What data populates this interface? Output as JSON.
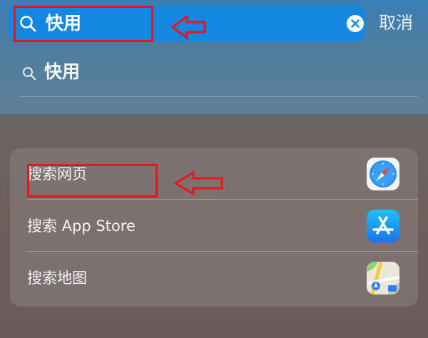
{
  "search": {
    "query": "快用",
    "cancel_label": "取消"
  },
  "suggestion": {
    "text": "快用"
  },
  "results": [
    {
      "label": "搜索网页",
      "icon": "safari-icon"
    },
    {
      "label": "搜索 App Store",
      "icon": "app-store-icon"
    },
    {
      "label": "搜索地图",
      "icon": "maps-icon"
    }
  ],
  "colors": {
    "search_bar": "#1488e0",
    "annotation": "#e8161b",
    "app_store": "#1a8cf0"
  }
}
